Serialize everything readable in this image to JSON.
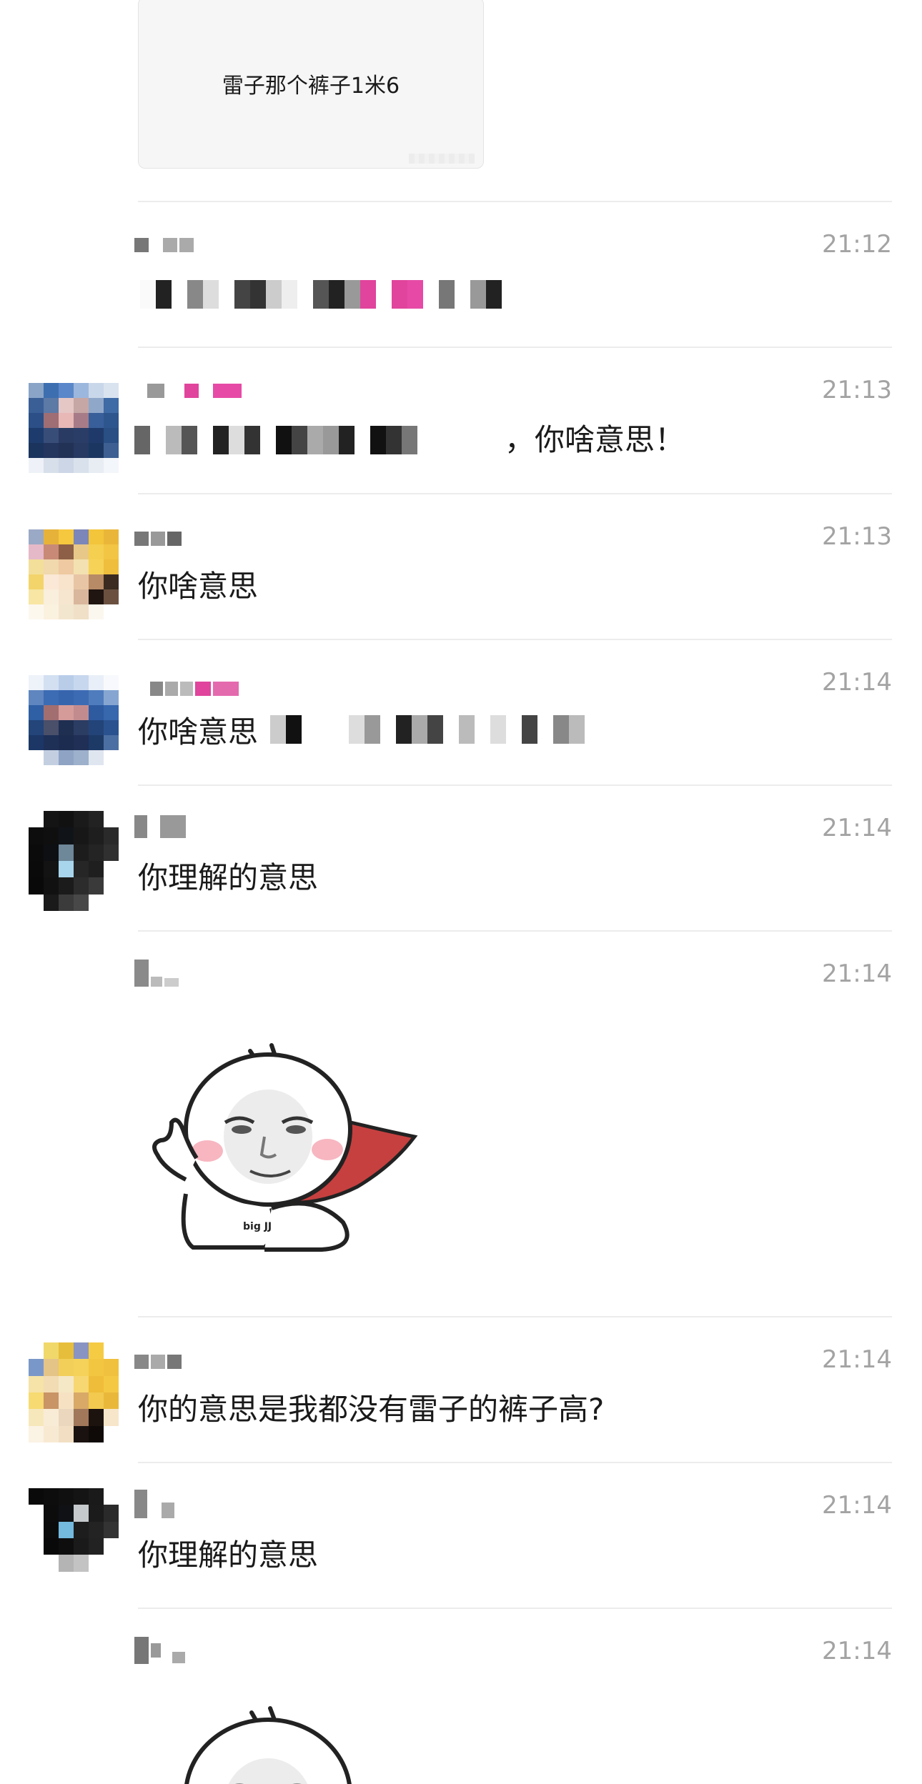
{
  "quote": {
    "text": "雷子那个裤子1米6"
  },
  "messages": [
    {
      "time": "21:12",
      "text": ""
    },
    {
      "time": "21:13",
      "text": "，你啥意思！"
    },
    {
      "time": "21:13",
      "text": "你啥意思"
    },
    {
      "time": "21:14",
      "text": "你啥意思"
    },
    {
      "time": "21:14",
      "text": "你理解的意思"
    },
    {
      "time": "21:14",
      "text": "",
      "sticker_caption": "big JJ"
    },
    {
      "time": "21:14",
      "text": "你的意思是我都没有雷子的裤子高?"
    },
    {
      "time": "21:14",
      "text": "你理解的意思"
    },
    {
      "time": "21:14",
      "text": ""
    }
  ],
  "colors": {
    "timestamp": "#a3a3a3",
    "divider": "#ececec",
    "pink": "#e0449c",
    "cape": "#c6403f"
  },
  "icons": {
    "sticker": "meme-baby-face-sticker"
  }
}
